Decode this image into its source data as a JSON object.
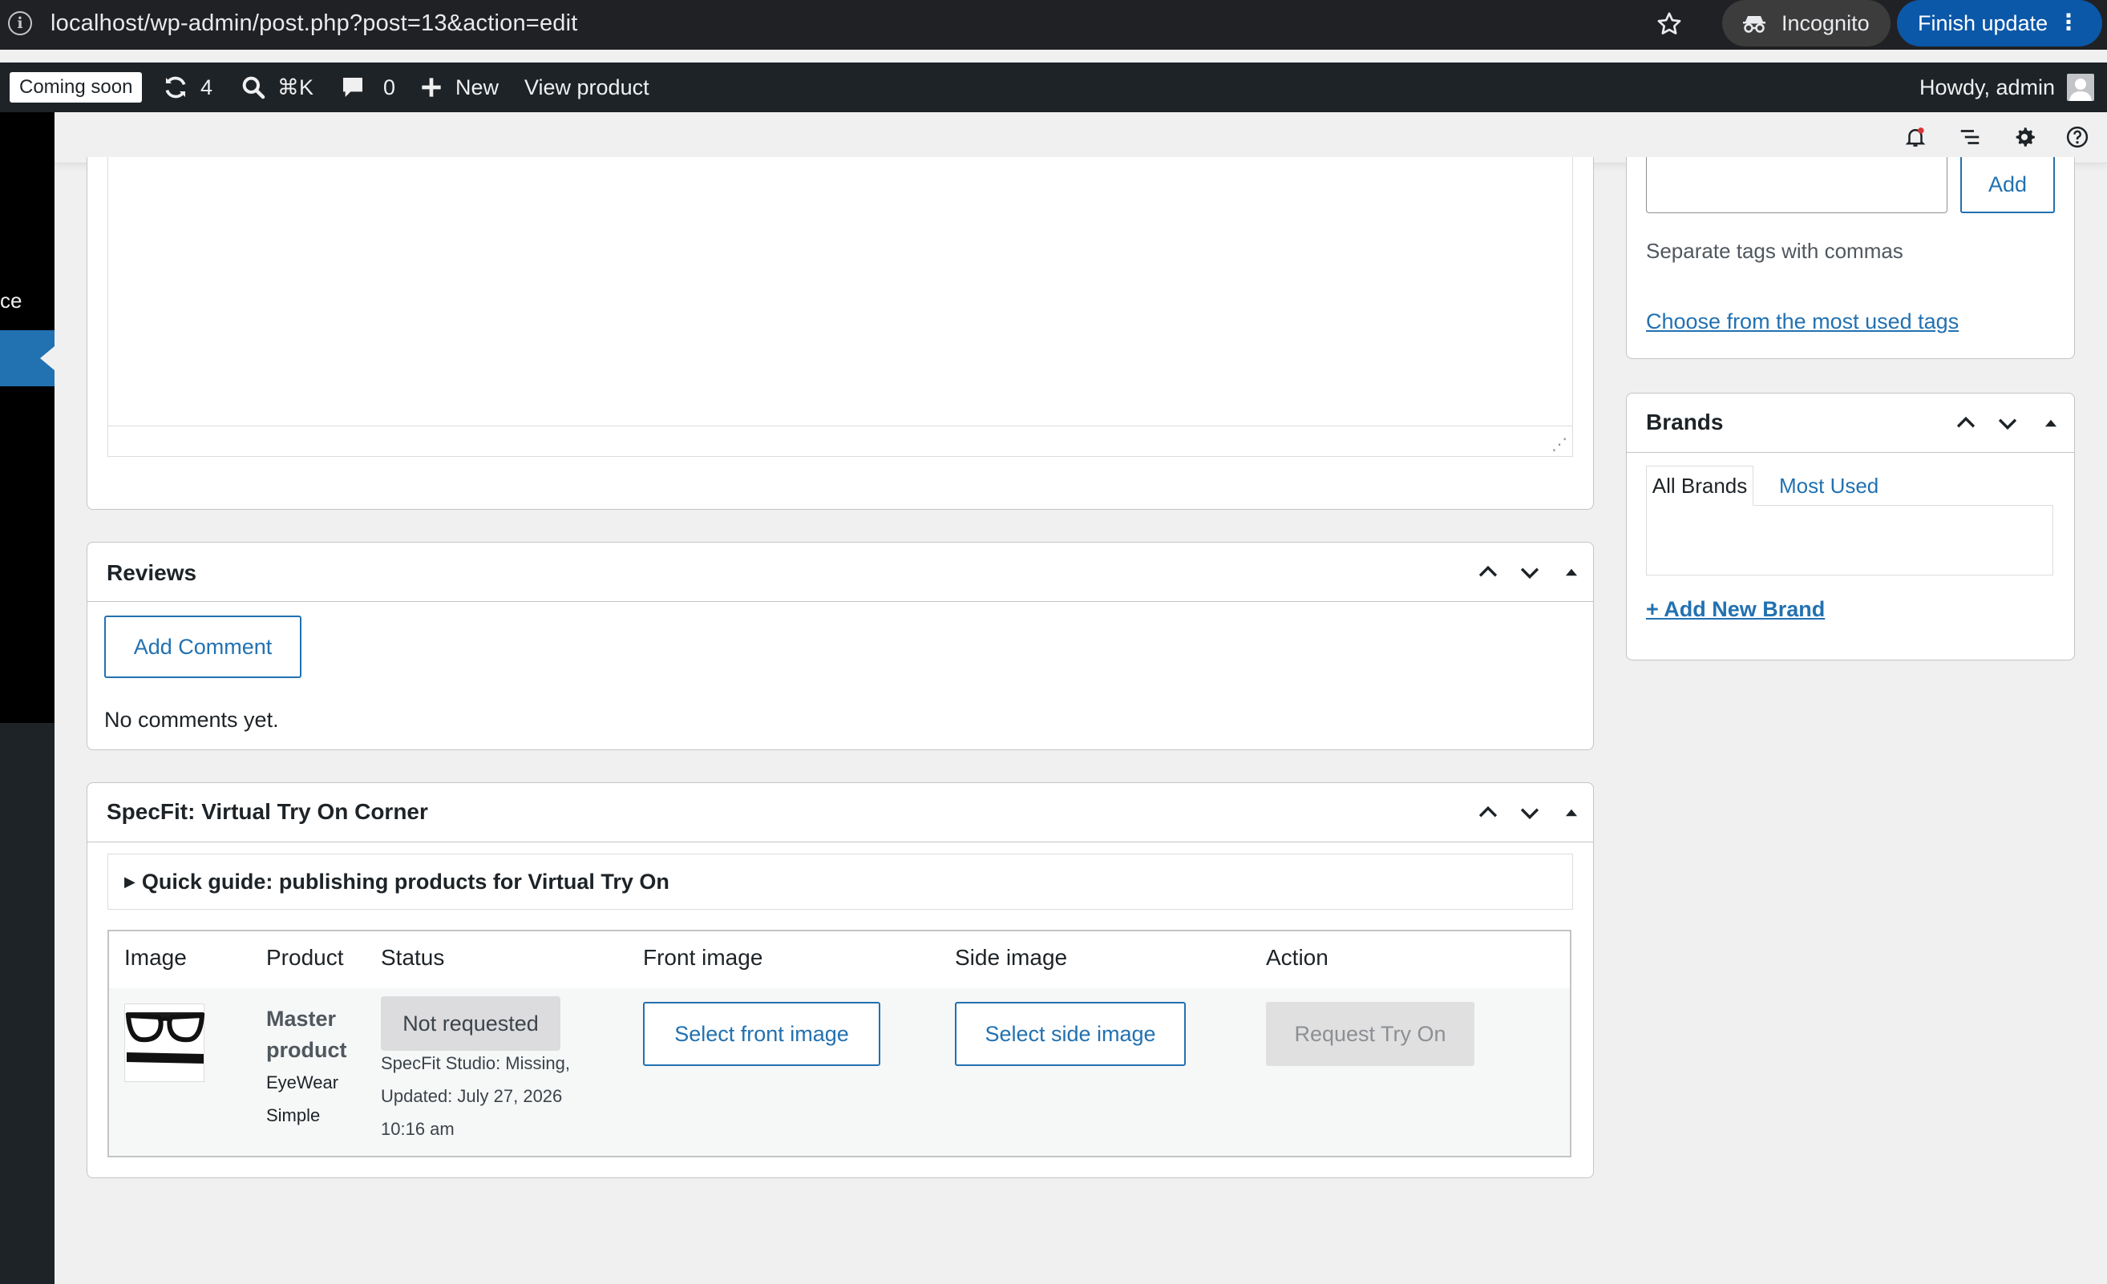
{
  "browser": {
    "url": "localhost/wp-admin/post.php?post=13&action=edit",
    "incognito_label": "Incognito",
    "finish_update_label": "Finish update",
    "menu_glyph": "⋮",
    "info_glyph": "i"
  },
  "admin_bar": {
    "coming_soon": "Coming soon",
    "updates_count": "4",
    "search_shortcut": "⌘K",
    "comments_count": "0",
    "new_label": "New",
    "view_product": "View product",
    "howdy": "Howdy, admin"
  },
  "sidebar": {
    "partial_text": "ce"
  },
  "description_editor": {
    "resize_glyph": "⋰"
  },
  "tags_box": {
    "add_label": "Add",
    "hint": "Separate tags with commas",
    "most_used_link": "Choose from the most used tags"
  },
  "brands_box": {
    "title": "Brands",
    "tabs": [
      "All Brands",
      "Most Used"
    ],
    "add_new_link": "+ Add New Brand"
  },
  "reviews_box": {
    "title": "Reviews",
    "add_comment": "Add Comment",
    "empty_text": "No comments yet."
  },
  "specfit_box": {
    "title": "SpecFit: Virtual Try On Corner",
    "guide_marker": "▶",
    "guide_label": "Quick guide: publishing products for Virtual Try On",
    "columns": [
      "Image",
      "Product",
      "Status",
      "Front image",
      "Side image",
      "Action"
    ],
    "row": {
      "product_name_line1": "Master",
      "product_name_line2": "product",
      "category": "EyeWear",
      "type": "Simple",
      "status_badge": "Not requested",
      "status_line1": "SpecFit Studio: Missing,",
      "status_line2": "Updated: July 27, 2026",
      "status_line3": "10:16 am",
      "select_front": "Select front image",
      "select_side": "Select side image",
      "request_try_on": "Request Try On"
    }
  },
  "colors": {
    "wp_blue": "#2271b1",
    "admin_bar": "#1d2327",
    "chrome_dark": "#202124",
    "finish_update_blue": "#0b57a8",
    "notification_red": "#d63638"
  }
}
